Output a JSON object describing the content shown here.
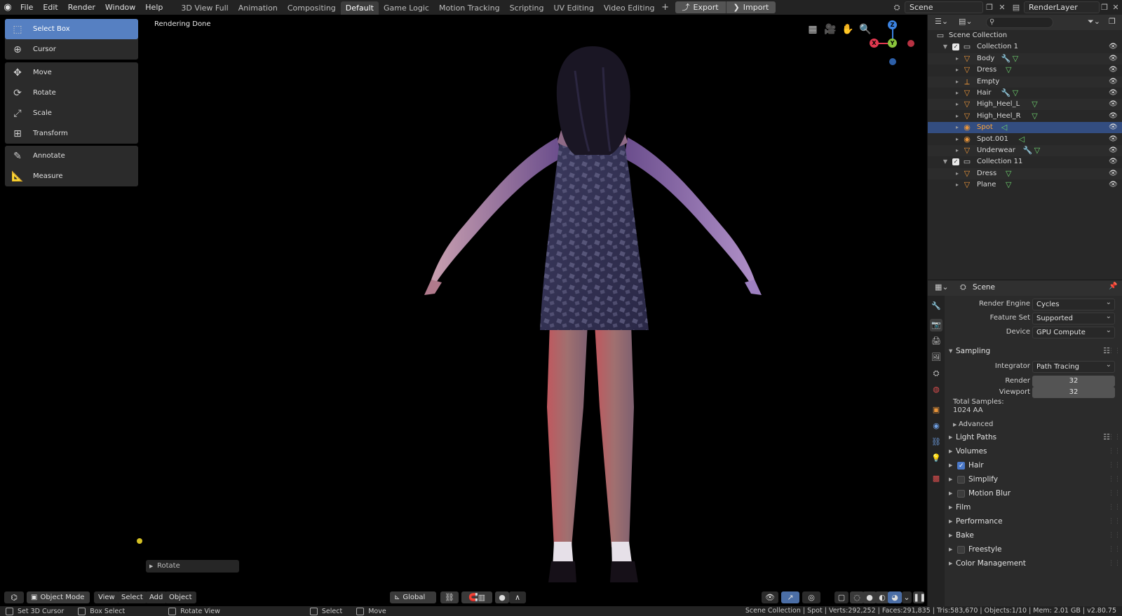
{
  "menubar": {
    "items": [
      "File",
      "Edit",
      "Render",
      "Window",
      "Help"
    ],
    "workspaces": [
      "3D View Full",
      "Animation",
      "Compositing",
      "Default",
      "Game Logic",
      "Motion Tracking",
      "Scripting",
      "UV Editing",
      "Video Editing"
    ],
    "active_workspace": "Default",
    "export_label": "Export",
    "import_label": "Import",
    "scene_name": "Scene",
    "layer_name": "RenderLayer"
  },
  "viewport": {
    "status": "Rendering Done",
    "last_operator": "Rotate"
  },
  "toolbar": {
    "select_box": "Select Box",
    "cursor": "Cursor",
    "move": "Move",
    "rotate": "Rotate",
    "scale": "Scale",
    "transform": "Transform",
    "annotate": "Annotate",
    "measure": "Measure"
  },
  "gizmo": {
    "z": "Z",
    "y": "Y",
    "x": "X"
  },
  "viewport_header": {
    "mode": "Object Mode",
    "view": "View",
    "select": "Select",
    "add": "Add",
    "object": "Object",
    "orientation": "Global"
  },
  "statusbar": {
    "set_cursor": "Set 3D Cursor",
    "box_select": "Box Select",
    "rotate_view": "Rotate View",
    "select": "Select",
    "move": "Move",
    "stats": "Scene Collection | Spot | Verts:292,252 | Faces:291,835 | Tris:583,670 | Objects:1/10 | Mem: 2.01 GB | v2.80.75"
  },
  "outliner": {
    "root": "Scene Collection",
    "rows": [
      {
        "label": "Collection 1",
        "type": "collection",
        "depth": 1
      },
      {
        "label": "Body",
        "type": "mesh",
        "depth": 2,
        "mods": [
          "wrench",
          "mesh"
        ]
      },
      {
        "label": "Dress",
        "type": "mesh",
        "depth": 2,
        "mods": [
          "mesh"
        ]
      },
      {
        "label": "Empty",
        "type": "empty",
        "depth": 2,
        "mods": []
      },
      {
        "label": "Hair",
        "type": "mesh",
        "depth": 2,
        "mods": [
          "wrench",
          "mesh"
        ]
      },
      {
        "label": "High_Heel_L",
        "type": "mesh",
        "depth": 2,
        "mods": [
          "mesh"
        ]
      },
      {
        "label": "High_Heel_R",
        "type": "mesh",
        "depth": 2,
        "mods": [
          "mesh"
        ]
      },
      {
        "label": "Spot",
        "type": "light",
        "depth": 2,
        "mods": [
          "light"
        ]
      },
      {
        "label": "Spot.001",
        "type": "light",
        "depth": 2,
        "mods": [
          "light"
        ]
      },
      {
        "label": "Underwear",
        "type": "mesh",
        "depth": 2,
        "mods": [
          "wrench",
          "mesh"
        ]
      },
      {
        "label": "Collection 11",
        "type": "collection",
        "depth": 1
      },
      {
        "label": "Dress",
        "type": "mesh",
        "depth": 2,
        "mods": [
          "mesh"
        ]
      },
      {
        "label": "Plane",
        "type": "mesh",
        "depth": 2,
        "mods": [
          "mesh"
        ]
      }
    ],
    "selected": "Spot"
  },
  "properties": {
    "context": "Scene",
    "render_engine_label": "Render Engine",
    "render_engine": "Cycles",
    "feature_set_label": "Feature Set",
    "feature_set": "Supported",
    "device_label": "Device",
    "device": "GPU Compute",
    "sampling": "Sampling",
    "integrator_label": "Integrator",
    "integrator": "Path Tracing",
    "render_label": "Render",
    "render_samples": "32",
    "viewport_label": "Viewport",
    "viewport_samples": "32",
    "total_samples_label": "Total Samples:",
    "total_samples": "1024 AA",
    "advanced": "Advanced",
    "light_paths": "Light Paths",
    "volumes": "Volumes",
    "hair": "Hair",
    "simplify": "Simplify",
    "motion_blur": "Motion Blur",
    "film": "Film",
    "performance": "Performance",
    "bake": "Bake",
    "freestyle": "Freestyle",
    "color_management": "Color Management"
  },
  "colors": {
    "accent": "#5680c2",
    "selected_row": "#334d80",
    "selected_text": "#ffa53a",
    "mesh_icon": "#e8943a",
    "modifier_icon": "#6d9de0",
    "mesh_data": "#6fd36f",
    "axis_x": "#e0384f",
    "axis_y": "#8ac53c",
    "axis_z": "#3b82e0"
  }
}
